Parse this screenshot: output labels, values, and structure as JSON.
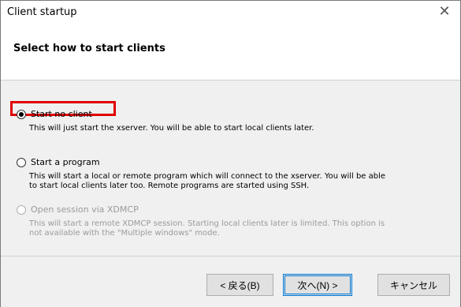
{
  "window": {
    "title": "Client startup",
    "close_icon": "close-icon"
  },
  "header": {
    "heading": "Select how to start clients"
  },
  "options": [
    {
      "label": "Start no client",
      "selected": true,
      "enabled": true,
      "description": [
        "This will just start the xserver. You will be able to start local clients later."
      ]
    },
    {
      "label": "Start a program",
      "selected": false,
      "enabled": true,
      "description": [
        "This will start a local or remote program which will connect to the xserver. You will be able",
        "to start local clients later too. Remote programs are started using SSH."
      ]
    },
    {
      "label": "Open session via XDMCP",
      "selected": false,
      "enabled": false,
      "description": [
        "This will start a remote XDMCP session. Starting local clients later is limited. This option is",
        "not available with the \"Multiple windows\" mode."
      ]
    }
  ],
  "buttons": {
    "back": "< 戻る(B)",
    "next": "次へ(N) >",
    "cancel": "キャンセル"
  },
  "colors": {
    "highlight": "#e00000",
    "default_button_border": "#0078d7"
  }
}
